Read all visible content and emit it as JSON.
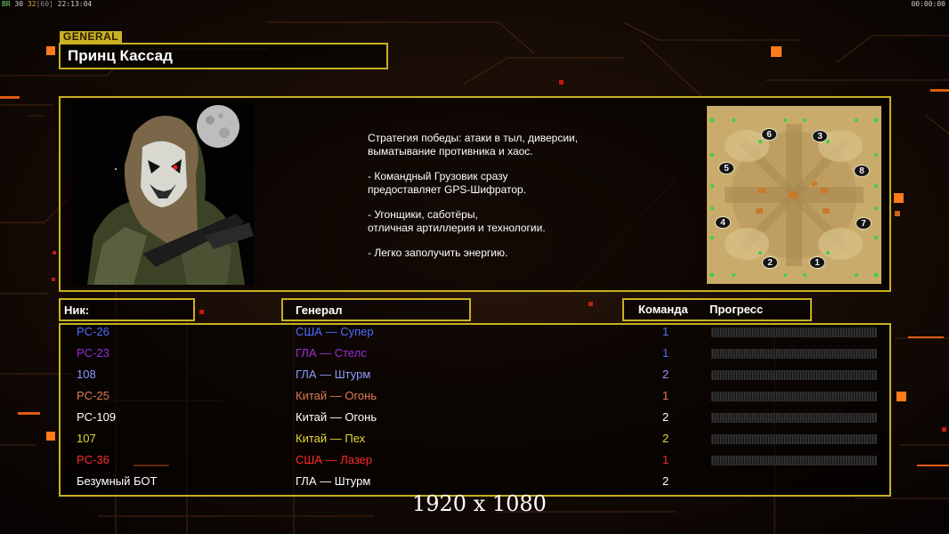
{
  "hud": {
    "rate_prefix": "BR",
    "rate_a": "30",
    "rate_b": "32",
    "rate_c": "[60]",
    "clock": "22:13:04",
    "timer": "00:00:00"
  },
  "general_tag": "GENERAL",
  "general_name": "Принц Кассад",
  "description": [
    "Стратегия победы: атаки в тыл, диверсии,\n выматывание противника и хаос.",
    "- Командный Грузовик сразу\nпредоставляет GPS-Шифратор.",
    "- Угонщики, саботёры,\nотличная артиллерия и технологии.",
    "- Легко заполучить энергию."
  ],
  "map_slots": [
    "6",
    "3",
    "5",
    "8",
    "4",
    "7",
    "2",
    "1"
  ],
  "headers": {
    "nick": "Ник:",
    "general": "Генерал",
    "team": "Команда",
    "progress": "Прогресс"
  },
  "players": [
    {
      "nick": "PC-26",
      "general": "США — Супер",
      "team": "1",
      "color": "#4f6bff",
      "team_color": "#4f6bff",
      "progress": 0
    },
    {
      "nick": "PC-23",
      "general": "ГЛА — Стелс",
      "team": "1",
      "color": "#9b2fd6",
      "team_color": "#4f6bff",
      "progress": 0
    },
    {
      "nick": "108",
      "general": "ГЛА — Штурм",
      "team": "2",
      "color": "#8f9bff",
      "team_color": "#8f9bff",
      "progress": 0
    },
    {
      "nick": "PC-25",
      "general": "Китай — Огонь",
      "team": "1",
      "color": "#e07a55",
      "team_color": "#e07a55",
      "progress": 0
    },
    {
      "nick": "PC-109",
      "general": "Китай — Огонь",
      "team": "2",
      "color": "#ffffff",
      "team_color": "#ffffff",
      "progress": 0
    },
    {
      "nick": "107",
      "general": "Китай — Пех",
      "team": "2",
      "color": "#e8d83a",
      "team_color": "#e8d83a",
      "progress": 0
    },
    {
      "nick": "PC-36",
      "general": "США — Лазер",
      "team": "1",
      "color": "#ff2a2a",
      "team_color": "#ff2a2a",
      "progress": 0
    },
    {
      "nick": "Безумный БОТ",
      "general": "ГЛА — Штурм",
      "team": "2",
      "color": "#ffffff",
      "team_color": "#ffffff",
      "progress": null
    }
  ],
  "resolution": "1920 x 1080",
  "colors": {
    "frame": "#c9b020",
    "accent_orange": "#ff7a00"
  }
}
